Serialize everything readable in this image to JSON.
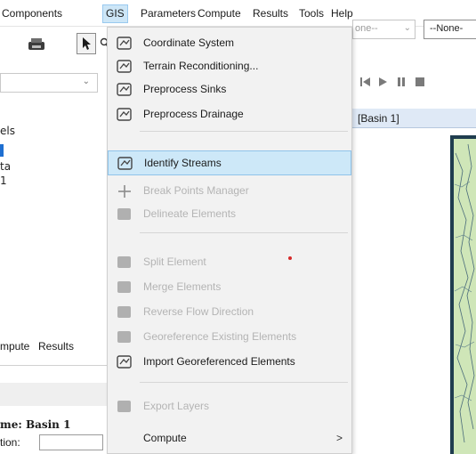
{
  "menubar": {
    "items": [
      "Components",
      "GIS",
      "Parameters",
      "Compute",
      "Results",
      "Tools",
      "Help"
    ]
  },
  "toolbar": {
    "icons": [
      "print-icon",
      "select-arrow-icon",
      "zoom-icon"
    ],
    "combo_right_1": "one--",
    "combo_right_2": "--None-",
    "play_controls": [
      "skip-back-icon",
      "play-icon",
      "pause-icon",
      "stop-icon"
    ]
  },
  "left_panel": {
    "tree": [
      "els",
      "ta",
      "1"
    ],
    "tabs": [
      "mpute",
      "Results"
    ],
    "properties_name": "me: Basin 1",
    "properties_desc_label": "tion:"
  },
  "basin_tab": {
    "label": "[Basin 1]"
  },
  "gis_menu": {
    "items": [
      {
        "label": "Coordinate System",
        "enabled": true,
        "icon": "gis-layer-icon"
      },
      {
        "label": "Terrain Reconditioning...",
        "enabled": true,
        "icon": "gis-layer-icon"
      },
      {
        "label": "Preprocess Sinks",
        "enabled": true,
        "icon": "gis-layer-icon"
      },
      {
        "label": "Preprocess Drainage",
        "enabled": true,
        "icon": "gis-layer-icon"
      },
      {
        "label": "Identify Streams",
        "enabled": true,
        "highlighted": true,
        "icon": "gis-layer-icon"
      },
      {
        "label": "Break Points Manager",
        "enabled": false,
        "icon": "crosshair-icon"
      },
      {
        "label": "Delineate Elements",
        "enabled": false,
        "icon": "gis-layer-icon"
      },
      {
        "label": "Split Element",
        "enabled": false,
        "icon": "gis-layer-icon"
      },
      {
        "label": "Merge Elements",
        "enabled": false,
        "icon": "gis-layer-icon"
      },
      {
        "label": "Reverse Flow Direction",
        "enabled": false,
        "icon": "gis-layer-icon"
      },
      {
        "label": "Georeference Existing Elements",
        "enabled": false,
        "icon": "gis-layer-icon"
      },
      {
        "label": "Import Georeferenced Elements",
        "enabled": true,
        "icon": "gis-layer-icon"
      },
      {
        "label": "Export Layers",
        "enabled": false,
        "icon": "gis-layer-icon"
      },
      {
        "label": "Compute",
        "enabled": true,
        "submenu": true
      },
      {
        "label": ">"
      }
    ]
  },
  "colors": {
    "highlight": "#cde8f8",
    "highlight_border": "#8fc3ea",
    "menu_bg": "#f2f2f2",
    "disabled_text": "#b4b4b4",
    "map_green": "#cfe6b8"
  }
}
